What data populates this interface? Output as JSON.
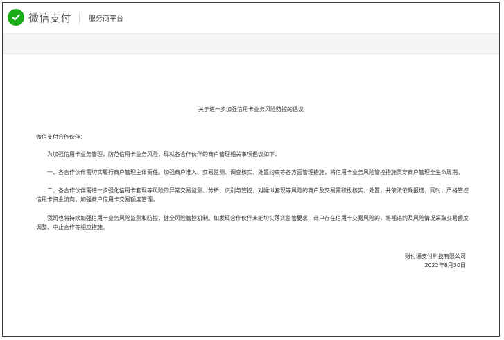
{
  "header": {
    "brand": "微信支付",
    "platform": "服务商平台"
  },
  "notice": {
    "title": "关于进一步加强信用卡业务风险防控的倡议",
    "greeting": "微信支付合作伙伴：",
    "intro": "为加强信用卡业务管理，防范信用卡业务风险，现就各合作伙伴的商户管理相关事项倡议如下：",
    "item1": "一、各合作伙伴需切实履行商户管理主体责任。加强商户准入、交易监测、调查核实、处置约束等各方面管理措施，将信用卡业务风险管控措施贯穿商户管理全生命周期。",
    "item2": "二、各合作伙伴需进一步强化信用卡套现等风险的异常交易监测、分析、识别与管控，对疑似套现等风险的商户及交易需积极核实、处置，并依法依规报送；同时，严格管控信用卡资金流向，加强商户信用卡交易额度管理。",
    "closing": "我司也将持续加强信用卡业务风险监测和防控，健全风险管控机制。如发现合作伙伴未能切实落实监管要求、商户存在信用卡交易风险的，将视违约及风险情况采取交易额度调整、中止合作等相应措施。",
    "company": "财付通支付科技有限公司",
    "date": "2022年8月30日"
  },
  "colors": {
    "brand_green": "#1aad19",
    "subbar_bg": "#f4f5f7"
  }
}
